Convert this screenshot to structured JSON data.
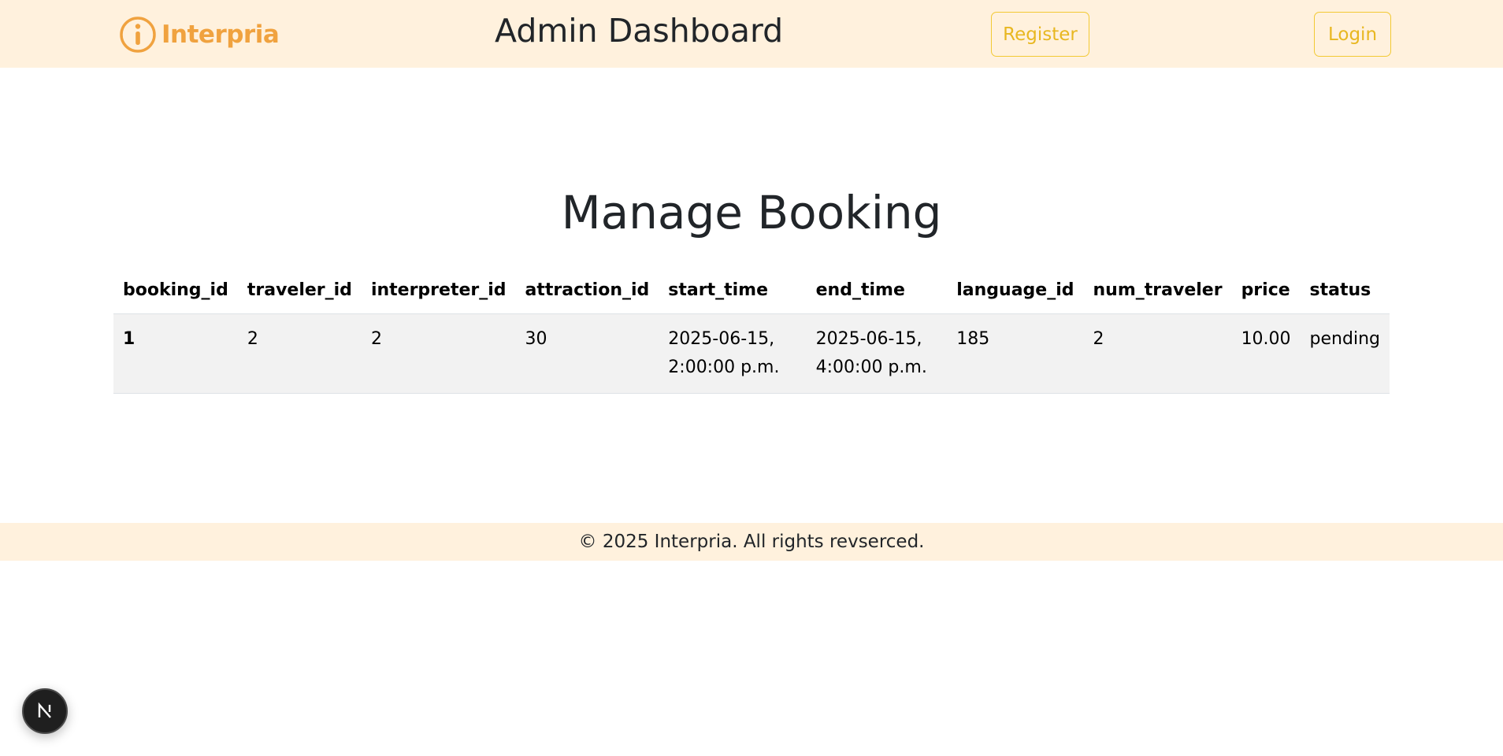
{
  "header": {
    "brand": "Interpria",
    "title": "Admin Dashboard",
    "register_label": "Register",
    "login_label": "Login",
    "brand_color": "#f0a23f",
    "button_accent": "#f2c933",
    "background": "#fff1dd"
  },
  "main": {
    "page_title": "Manage Booking",
    "table": {
      "columns": [
        "booking_id",
        "traveler_id",
        "interpreter_id",
        "attraction_id",
        "start_time",
        "end_time",
        "language_id",
        "num_traveler",
        "price",
        "status"
      ],
      "rows": [
        {
          "booking_id": "1",
          "traveler_id": "2",
          "interpreter_id": "2",
          "attraction_id": "30",
          "start_time": "2025-06-15, 2:00:00 p.m.",
          "end_time": "2025-06-15, 4:00:00 p.m.",
          "language_id": "185",
          "num_traveler": "2",
          "price": "10.00",
          "status": "pending"
        }
      ]
    }
  },
  "footer": {
    "text": "© 2025 Interpria. All rights revserced."
  },
  "icons": {
    "logo": "info-circle-icon",
    "dev_badge": "nextjs-logo-icon"
  }
}
